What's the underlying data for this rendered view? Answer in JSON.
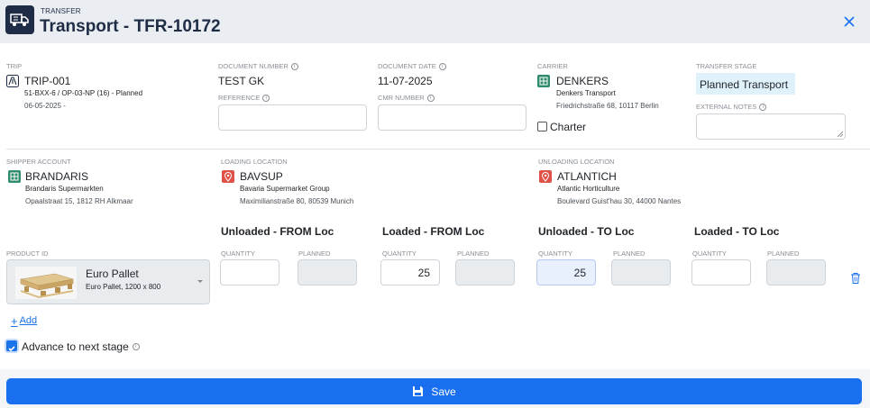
{
  "header": {
    "kicker": "TRANSFER",
    "title": "Transport - TFR-10172",
    "icon": "truck-icon"
  },
  "trip": {
    "label": "TRIP",
    "code": "TRIP-001",
    "detail": "51-BXX-6 / OP-03-NP (16) - Planned",
    "date": "06-05-2025 -"
  },
  "document_number": {
    "label": "DOCUMENT NUMBER",
    "value": "TEST GK"
  },
  "reference": {
    "label": "REFERENCE",
    "value": ""
  },
  "document_date": {
    "label": "DOCUMENT DATE",
    "value": "11-07-2025"
  },
  "cmr_number": {
    "label": "CMR NUMBER",
    "value": ""
  },
  "carrier": {
    "label": "CARRIER",
    "code": "DENKERS",
    "name": "Denkers Transport",
    "address": "Friedrichstraße 68, 10117 Berlin"
  },
  "charter": {
    "label": "Charter",
    "checked": false
  },
  "transfer_stage": {
    "label": "TRANSFER STAGE",
    "value": "Planned Transport"
  },
  "external_notes": {
    "label": "EXTERNAL NOTES",
    "value": ""
  },
  "shipper": {
    "label": "SHIPPER ACCOUNT",
    "code": "BRANDARIS",
    "name": "Brandaris Supermarkten",
    "address": "Opaalstraat 15, 1812 RH Alkmaar"
  },
  "loading": {
    "label": "LOADING LOCATION",
    "code": "BAVSUP",
    "name": "Bavaria Supermarket Group",
    "address": "Maximilianstraße 80, 80539 Munich"
  },
  "unloading": {
    "label": "UNLOADING LOCATION",
    "code": "ATLANTICH",
    "name": "Atlantic Horticulture",
    "address": "Boulevard Guist'hau 30, 44000 Nantes"
  },
  "product": {
    "label": "PRODUCT ID",
    "name": "Euro Pallet",
    "desc": "Euro Pallet, 1200 x 800"
  },
  "groups": [
    {
      "title": "Unloaded - FROM Loc",
      "quantity_label": "QUANTITY",
      "planned_label": "PLANNED",
      "quantity": "",
      "planned": ""
    },
    {
      "title": "Loaded - FROM Loc",
      "quantity_label": "QUANTITY",
      "planned_label": "PLANNED",
      "quantity": "25",
      "planned": ""
    },
    {
      "title": "Unloaded - TO Loc",
      "quantity_label": "QUANTITY",
      "planned_label": "PLANNED",
      "quantity": "25",
      "planned": ""
    },
    {
      "title": "Loaded - TO Loc",
      "quantity_label": "QUANTITY",
      "planned_label": "PLANNED",
      "quantity": "",
      "planned": ""
    }
  ],
  "add_label": "Add",
  "advance": {
    "label": "Advance to next stage",
    "checked": true
  },
  "save_label": "Save",
  "colors": {
    "primary": "#1a6ff0",
    "header_bg": "#eaeef3",
    "brand_dark": "#1f2c45",
    "stage_bg": "#dff1fb"
  }
}
